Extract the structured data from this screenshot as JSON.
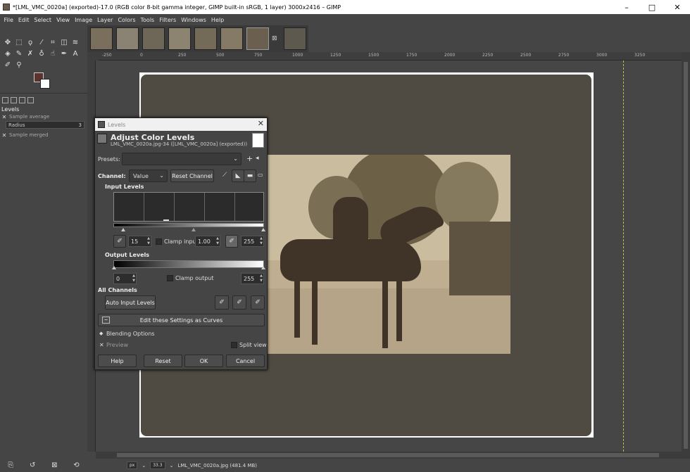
{
  "window": {
    "title": "*[LML_VMC_0020a] (exported)-17.0 (RGB color 8-bit gamma integer, GIMP built-in sRGB, 1 layer) 3000x2416 – GIMP"
  },
  "menu": [
    "File",
    "Edit",
    "Select",
    "View",
    "Image",
    "Layer",
    "Colors",
    "Tools",
    "Filters",
    "Windows",
    "Help"
  ],
  "tool_options": {
    "title": "Levels",
    "sample_average": "Sample average",
    "radius_label": "Radius",
    "radius_value": "3",
    "sample_merged": "Sample merged"
  },
  "ruler": {
    "ticks": [
      "-250",
      "0",
      "250",
      "500",
      "750",
      "1000",
      "1250",
      "1500",
      "1750",
      "2000",
      "2250",
      "2500",
      "2750",
      "3000",
      "3250"
    ]
  },
  "status": {
    "unit": "px",
    "zoom": "33.3",
    "file": "LML_VMC_0020a.jpg (481.4 MB)"
  },
  "dialog": {
    "window_title": "Levels",
    "heading": "Adjust Color Levels",
    "subheading": "LML_VMC_0020a.jpg-34 ([LML_VMC_0020a] (exported))",
    "presets_label": "Presets:",
    "presets_value": "",
    "channel_label": "Channel:",
    "channel_value": "Value",
    "reset_channel": "Reset Channel",
    "input_levels": "Input Levels",
    "input_low": "15",
    "clamp_input": "Clamp input",
    "gamma": "1.00",
    "input_high": "255",
    "output_levels": "Output Levels",
    "output_low": "0",
    "clamp_output": "Clamp output",
    "output_high": "255",
    "all_channels": "All Channels",
    "auto_input": "Auto Input Levels",
    "edit_curves": "Edit these Settings as Curves",
    "blending": "Blending Options",
    "preview": "Preview",
    "split_view": "Split view",
    "help": "Help",
    "reset": "Reset",
    "ok": "OK",
    "cancel": "Cancel"
  },
  "colors": {
    "fg": "#5c322c",
    "bg": "#ffffff",
    "mount": "#4f4b43",
    "photo": "#bfae90"
  }
}
